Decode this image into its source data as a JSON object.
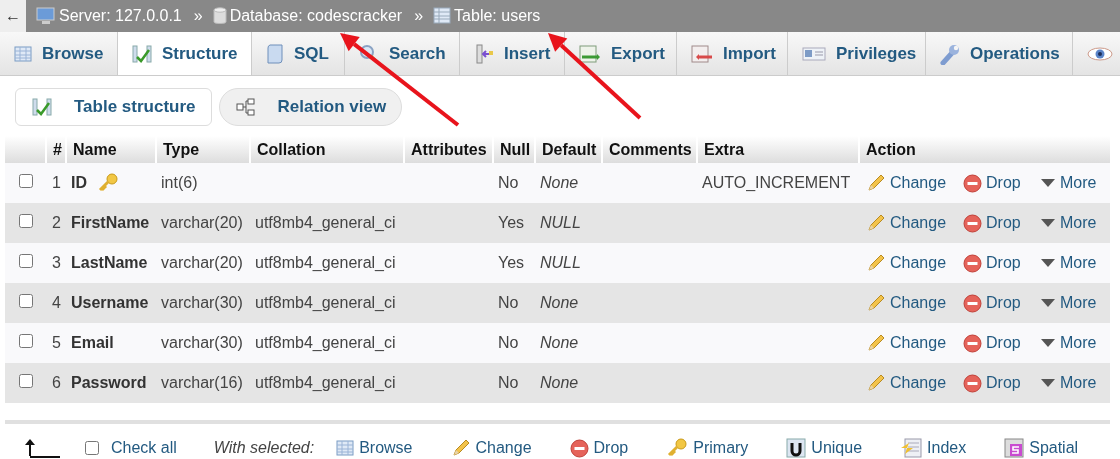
{
  "breadcrumb": {
    "back": "←",
    "items": [
      {
        "kind": "server",
        "label": "Server: 127.0.0.1"
      },
      {
        "kind": "database",
        "label": "Database: codescracker"
      },
      {
        "kind": "table",
        "label": "Table: users"
      }
    ],
    "separator": "»"
  },
  "tabs": [
    {
      "label": "Browse",
      "selected": false
    },
    {
      "label": "Structure",
      "selected": true
    },
    {
      "label": "SQL",
      "selected": false
    },
    {
      "label": "Search",
      "selected": false
    },
    {
      "label": "Insert",
      "selected": false
    },
    {
      "label": "Export",
      "selected": false
    },
    {
      "label": "Import",
      "selected": false
    },
    {
      "label": "Privileges",
      "selected": false
    },
    {
      "label": "Operations",
      "selected": false
    },
    {
      "selected": false
    }
  ],
  "subtabs": [
    {
      "label": "Table structure",
      "selected": true
    },
    {
      "label": "Relation view",
      "selected": false
    }
  ],
  "table": {
    "columns": [
      "#",
      "Name",
      "Type",
      "Collation",
      "Attributes",
      "Null",
      "Default",
      "Comments",
      "Extra",
      "Action"
    ],
    "rows": [
      {
        "checked": false,
        "num": "1",
        "name": "ID",
        "primary": true,
        "type": "int(6)",
        "collation": "",
        "null": "No",
        "default": "None",
        "extra": "AUTO_INCREMENT",
        "actions": [
          "Change",
          "Drop",
          "More"
        ]
      },
      {
        "checked": false,
        "num": "2",
        "name": "FirstName",
        "primary": false,
        "type": "varchar(20)",
        "collation": "utf8mb4_general_ci",
        "null": "Yes",
        "default": "NULL",
        "extra": "",
        "actions": [
          "Change",
          "Drop",
          "More"
        ]
      },
      {
        "checked": false,
        "num": "3",
        "name": "LastName",
        "primary": false,
        "type": "varchar(20)",
        "collation": "utf8mb4_general_ci",
        "null": "Yes",
        "default": "NULL",
        "extra": "",
        "actions": [
          "Change",
          "Drop",
          "More"
        ]
      },
      {
        "checked": false,
        "num": "4",
        "name": "Username",
        "primary": false,
        "type": "varchar(30)",
        "collation": "utf8mb4_general_ci",
        "null": "No",
        "default": "None",
        "extra": "",
        "actions": [
          "Change",
          "Drop",
          "More"
        ]
      },
      {
        "checked": false,
        "num": "5",
        "name": "Email",
        "primary": false,
        "type": "varchar(30)",
        "collation": "utf8mb4_general_ci",
        "null": "No",
        "default": "None",
        "extra": "",
        "actions": [
          "Change",
          "Drop",
          "More"
        ]
      },
      {
        "checked": false,
        "num": "6",
        "name": "Password",
        "primary": false,
        "type": "varchar(16)",
        "collation": "utf8mb4_general_ci",
        "null": "No",
        "default": "None",
        "extra": "",
        "actions": [
          "Change",
          "Drop",
          "More"
        ]
      }
    ]
  },
  "footer": {
    "check_all": {
      "label": "Check all",
      "checked": false
    },
    "with_selected": "With selected:",
    "actions": [
      "Browse",
      "Change",
      "Drop",
      "Primary",
      "Unique",
      "Index",
      "Spatial"
    ]
  },
  "annotations": [
    {
      "kind": "arrow"
    },
    {
      "kind": "arrow"
    }
  ]
}
